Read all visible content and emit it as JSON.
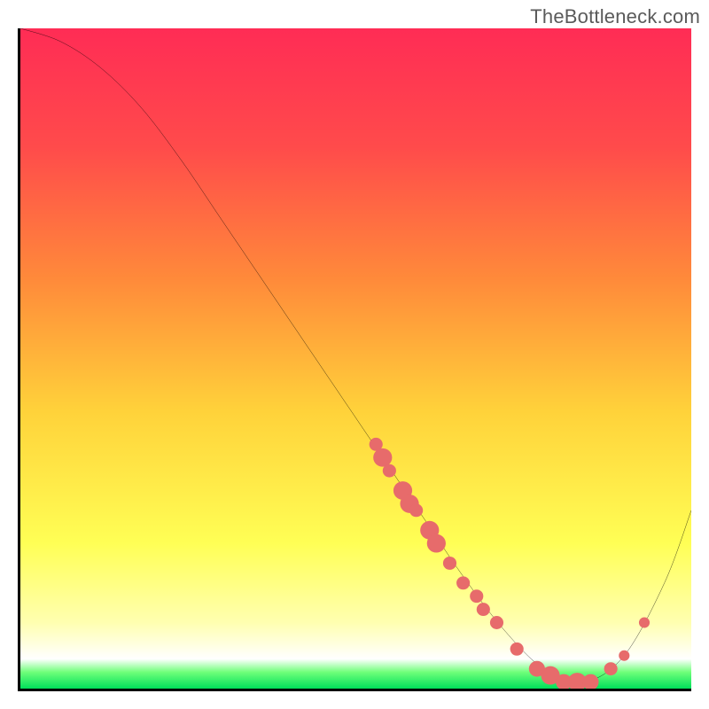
{
  "watermark": "TheBottleneck.com",
  "chart_data": {
    "type": "line",
    "title": "",
    "xlabel": "",
    "ylabel": "",
    "xlim": [
      0,
      100
    ],
    "ylim": [
      0,
      100
    ],
    "series": [
      {
        "name": "bottleneck-curve",
        "x": [
          0,
          6,
          12,
          18,
          24,
          30,
          36,
          42,
          48,
          54,
          60,
          66,
          72,
          78,
          84,
          90,
          96,
          100
        ],
        "y": [
          100,
          98,
          94,
          88,
          80,
          71,
          62,
          53,
          44,
          35,
          26,
          17,
          9,
          3,
          1,
          5,
          16,
          27
        ]
      }
    ],
    "gradient_stops": [
      {
        "offset": 0.0,
        "color": "#ff2c55"
      },
      {
        "offset": 0.18,
        "color": "#ff4b4b"
      },
      {
        "offset": 0.38,
        "color": "#ff8a3a"
      },
      {
        "offset": 0.58,
        "color": "#ffd23a"
      },
      {
        "offset": 0.78,
        "color": "#ffff55"
      },
      {
        "offset": 0.9,
        "color": "#ffffb0"
      },
      {
        "offset": 0.955,
        "color": "#ffffff"
      },
      {
        "offset": 0.975,
        "color": "#6fff7a"
      },
      {
        "offset": 1.0,
        "color": "#00e05a"
      }
    ],
    "scatter_points": {
      "name": "highlighted-points",
      "coords": [
        {
          "x": 53,
          "y": 37,
          "r": 1.0
        },
        {
          "x": 54,
          "y": 35,
          "r": 1.4
        },
        {
          "x": 55,
          "y": 33,
          "r": 1.0
        },
        {
          "x": 57,
          "y": 30,
          "r": 1.4
        },
        {
          "x": 58,
          "y": 28,
          "r": 1.4
        },
        {
          "x": 59,
          "y": 27,
          "r": 1.0
        },
        {
          "x": 61,
          "y": 24,
          "r": 1.4
        },
        {
          "x": 62,
          "y": 22,
          "r": 1.4
        },
        {
          "x": 64,
          "y": 19,
          "r": 1.0
        },
        {
          "x": 66,
          "y": 16,
          "r": 1.0
        },
        {
          "x": 68,
          "y": 14,
          "r": 1.0
        },
        {
          "x": 69,
          "y": 12,
          "r": 1.0
        },
        {
          "x": 71,
          "y": 10,
          "r": 1.0
        },
        {
          "x": 74,
          "y": 6,
          "r": 1.0
        },
        {
          "x": 77,
          "y": 3,
          "r": 1.2
        },
        {
          "x": 79,
          "y": 2,
          "r": 1.4
        },
        {
          "x": 81,
          "y": 1,
          "r": 1.2
        },
        {
          "x": 83,
          "y": 1,
          "r": 1.4
        },
        {
          "x": 85,
          "y": 1,
          "r": 1.2
        },
        {
          "x": 88,
          "y": 3,
          "r": 1.0
        },
        {
          "x": 90,
          "y": 5,
          "r": 0.8
        },
        {
          "x": 93,
          "y": 10,
          "r": 0.8
        }
      ]
    }
  }
}
